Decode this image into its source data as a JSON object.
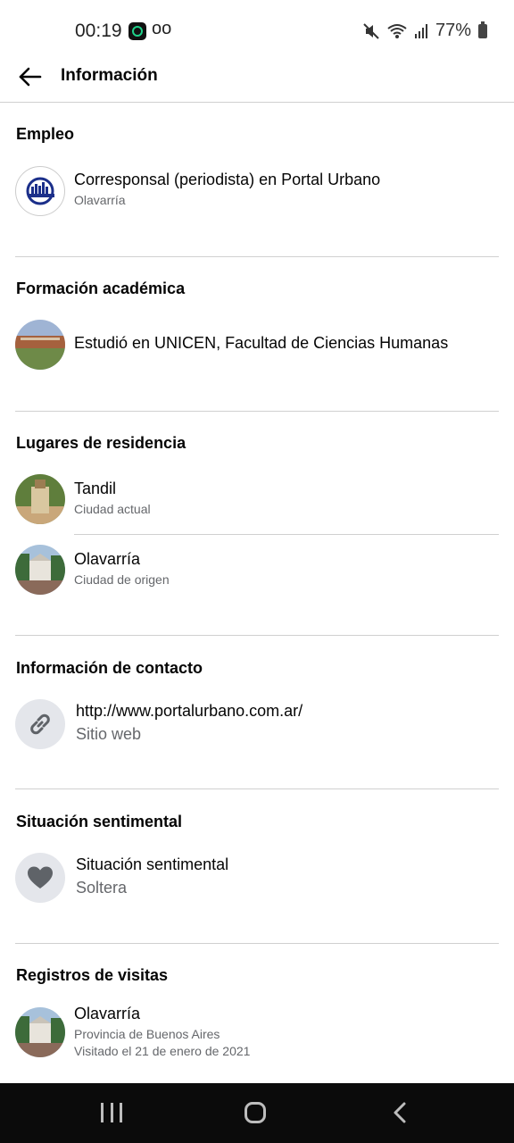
{
  "status": {
    "time": "00:19",
    "voicemail_glyph": "oo",
    "battery": "77%"
  },
  "header": {
    "title": "Información"
  },
  "sections": {
    "empleo": {
      "title": "Empleo",
      "items": [
        {
          "primary": "Corresponsal (periodista) en Portal Urbano",
          "secondary": "Olavarría",
          "icon": "portal-urbano-logo"
        }
      ]
    },
    "formacion": {
      "title": "Formación académica",
      "items": [
        {
          "primary": "Estudió en UNICEN, Facultad de Ciencias Humanas",
          "icon": "unicen-photo"
        }
      ]
    },
    "residencia": {
      "title": "Lugares de residencia",
      "items": [
        {
          "primary": "Tandil",
          "secondary": "Ciudad actual",
          "icon": "tandil-photo"
        },
        {
          "primary": "Olavarría",
          "secondary": "Ciudad de origen",
          "icon": "olavarria-photo"
        }
      ]
    },
    "contacto": {
      "title": "Información de contacto",
      "items": [
        {
          "primary": "http://www.portalurbano.com.ar/",
          "secondary": "Sitio web",
          "icon": "link-icon"
        }
      ]
    },
    "sentimental": {
      "title": "Situación sentimental",
      "items": [
        {
          "primary": "Situación sentimental",
          "secondary": "Soltera",
          "icon": "heart-icon"
        }
      ]
    },
    "visitas": {
      "title": "Registros de visitas",
      "items": [
        {
          "primary": "Olavarría",
          "secondary": "Provincia de Buenos Aires",
          "tertiary": "Visitado el 21 de enero de 2021",
          "icon": "olavarria-photo"
        }
      ]
    }
  }
}
